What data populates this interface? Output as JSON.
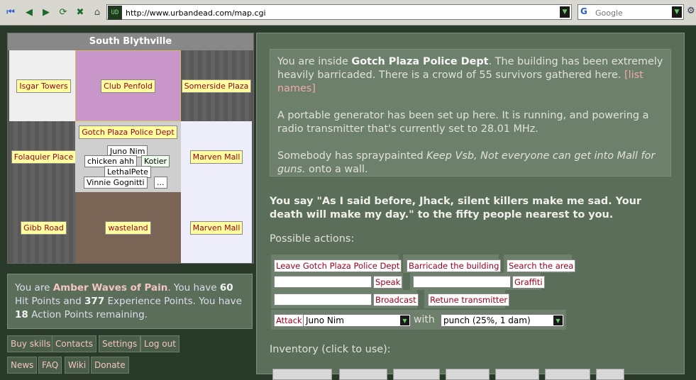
{
  "browser": {
    "url": "http://www.urbandead.com/map.cgi",
    "search_engine": "Google",
    "favicon_text": "UD"
  },
  "map": {
    "title": "South Blythville",
    "cells": [
      {
        "label": "Isgar Towers"
      },
      {
        "label": "Club Penfold"
      },
      {
        "label": "Somerside Plaza"
      },
      {
        "label": "Folaquier Place"
      },
      {
        "label": "Gotch Plaza Police Dept"
      },
      {
        "label": "Marven Mall"
      },
      {
        "label": "Gibb Road"
      },
      {
        "label": "wasteland"
      },
      {
        "label": "Marven Mall"
      }
    ],
    "zombies": [
      "Juno Nim",
      "chicken ahh",
      "Kotier",
      "LethalPete",
      "Vinnie Gognitti",
      "..."
    ]
  },
  "status": {
    "prefix": "You are ",
    "name": "Amber Waves of Pain",
    "hp_text": ". You have ",
    "hp": "60",
    "hp_suffix": " Hit Points and ",
    "xp": "377",
    "xp_suffix": " Experience Points. You have ",
    "ap": "18",
    "ap_suffix": " Action Points remaining."
  },
  "links": [
    "Buy skills",
    "Contacts",
    "Settings",
    "Log out",
    "News",
    "FAQ",
    "Wiki",
    "Donate"
  ],
  "description": {
    "p1_a": "You are inside ",
    "building": "Gotch Plaza Police Dept",
    "p1_b": ". The building has been extremely heavily barricaded. There is a crowd of 55 survivors gathered here. ",
    "list_names": "[list names]",
    "p2": "A portable generator has been set up here. It is running, and powering a radio transmitter that's currently set to 28.01 MHz.",
    "p3_a": "Somebody has spraypainted ",
    "graffiti": "Keep Vsb, Not everyone can get into Mall for guns.",
    "p3_b": " onto a wall."
  },
  "speech": "You say \"As I said before, Jhack, silent killers make me sad. Your death will make my day.\" to the fifty people nearest to you.",
  "actions": {
    "label": "Possible actions:",
    "leave": "Leave Gotch Plaza Police Dept",
    "barricade": "Barricade the building",
    "search": "Search the area",
    "speak": "Speak",
    "graffiti": "Graffiti",
    "broadcast": "Broadcast",
    "retune": "Retune transmitter",
    "attack": "Attack",
    "target": "Juno Nim",
    "with": "with",
    "weapon": "punch (25%, 1 dam)"
  },
  "inventory_label": "Inventory (click to use):"
}
